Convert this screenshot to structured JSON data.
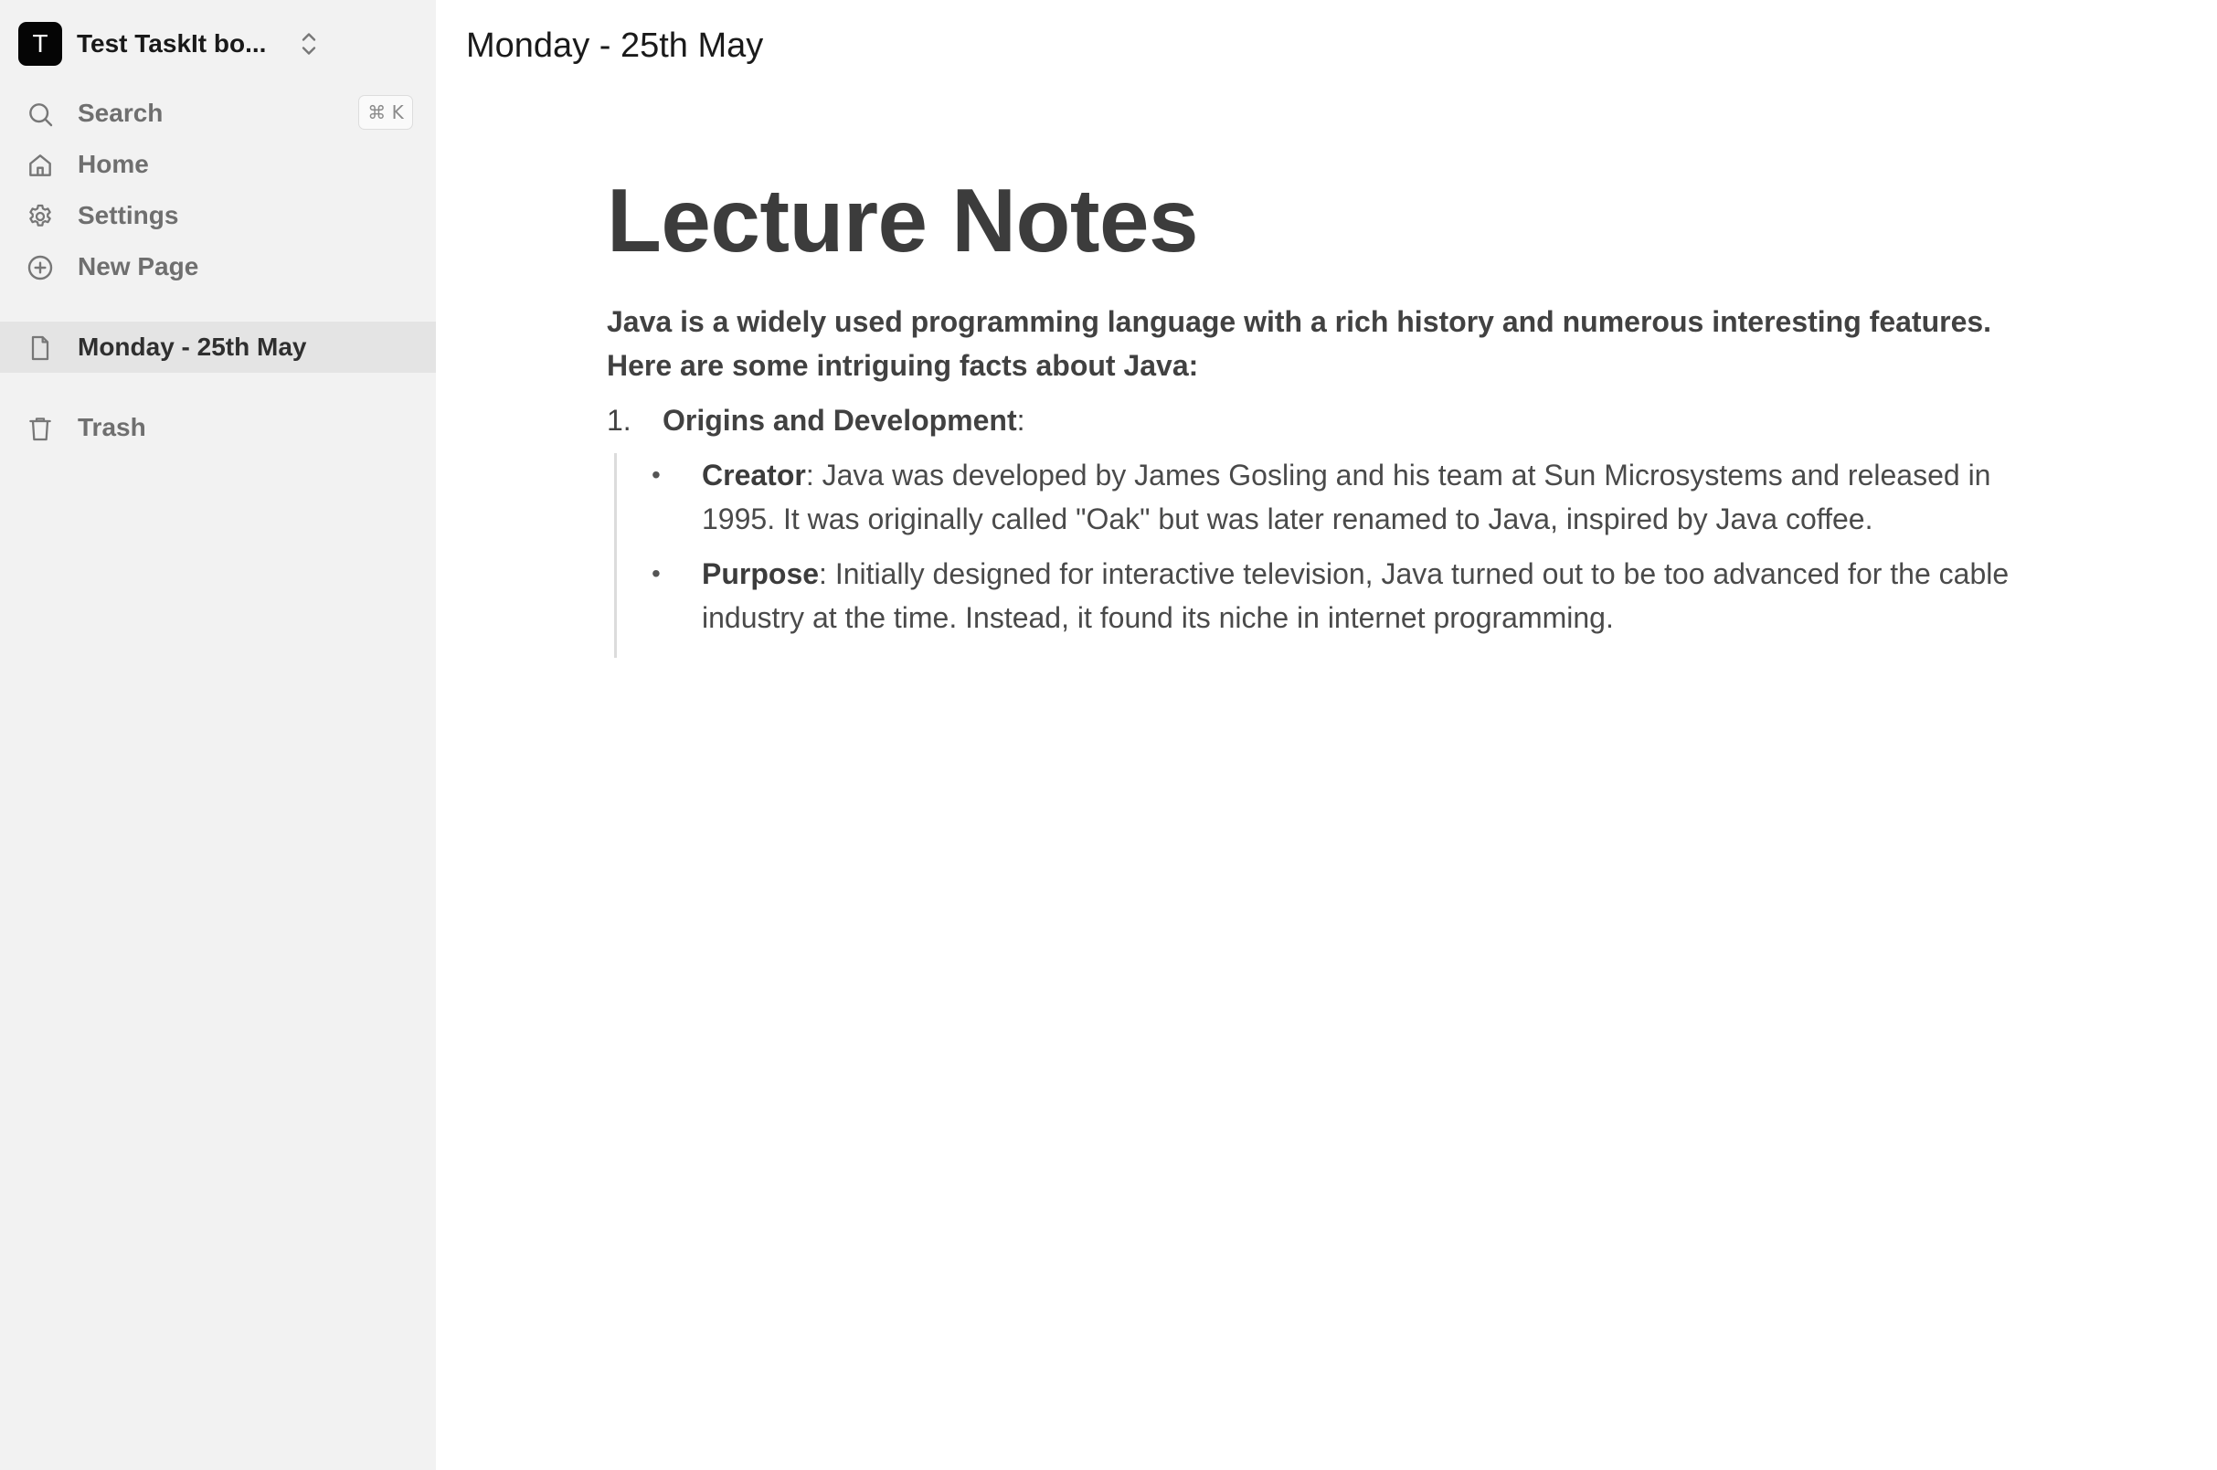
{
  "workspace": {
    "avatar_letter": "T",
    "name": "Test TaskIt bo..."
  },
  "sidebar": {
    "search_label": "Search",
    "search_shortcut": "⌘ K",
    "home_label": "Home",
    "settings_label": "Settings",
    "new_page_label": "New Page",
    "pages": [
      {
        "label": "Monday - 25th May",
        "active": true
      }
    ],
    "trash_label": "Trash"
  },
  "topbar": {
    "page_title": "Monday - 25th May"
  },
  "document": {
    "title": "Lecture Notes",
    "intro_line1": "Java is a widely used programming language with a rich history and numerous interesting features.",
    "intro_line2": "Here are some intriguing facts about Java:",
    "list": [
      {
        "number": "1.",
        "heading": "Origins and Development",
        "suffix": ":",
        "bullets": [
          {
            "term": "Creator",
            "text": ": Java was developed by James Gosling and his team at Sun Microsystems and released in 1995. It was originally called \"Oak\" but was later renamed to Java, inspired by Java coffee."
          },
          {
            "term": "Purpose",
            "text": ": Initially designed for interactive television, Java turned out to be too advanced for the cable industry at the time. Instead, it found its niche in internet programming."
          }
        ]
      }
    ]
  }
}
